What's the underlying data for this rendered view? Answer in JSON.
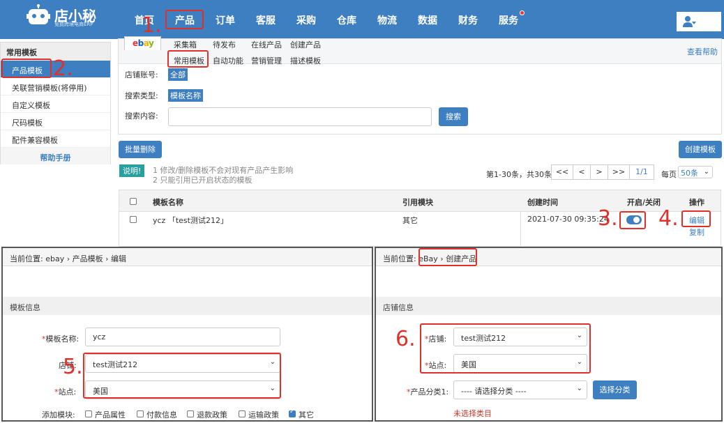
{
  "brand": {
    "name": "店小秘",
    "sub": "免费跨境电商ERP"
  },
  "nav": [
    "首页",
    "产品",
    "订单",
    "客服",
    "采购",
    "仓库",
    "物流",
    "数据",
    "财务",
    "服务"
  ],
  "annotations": [
    "1.",
    "2.",
    "3.",
    "4.",
    "5.",
    "6."
  ],
  "sidebar": {
    "title": "常用模板",
    "items": [
      "产品模板",
      "关联营销模板(将停用)",
      "自定义模板",
      "尺码模板",
      "配件兼容模板"
    ],
    "help": "帮助手册"
  },
  "tabs": {
    "platform": "ebay",
    "row1": [
      "采集箱",
      "待发布",
      "在线产品",
      "创建产品"
    ],
    "row2": [
      "常用模板",
      "自动功能",
      "营销管理",
      "描述模板"
    ],
    "help": "查看帮助"
  },
  "filters": {
    "shop_label": "店铺账号:",
    "shop_value": "全部",
    "search_type_label": "搜索类型:",
    "search_type_value": "模板名称",
    "search_content_label": "搜索内容:",
    "search_button": "搜索"
  },
  "actions": {
    "batch_delete": "批量删除",
    "create": "创建模板"
  },
  "notice": {
    "tag": "说明!",
    "lines": [
      "1 修改/删除模板不会对现有产品产生影响",
      "2 只能引用已开启状态的模板"
    ]
  },
  "pagination": {
    "summary": "第1-30条，共30条",
    "first": "<<",
    "prev": "<",
    "next": ">",
    "last": ">>",
    "page": "1/1",
    "per_page_label": "每页",
    "per_page": "50条"
  },
  "table": {
    "headers": [
      "模板名称",
      "引用模块",
      "创建时间",
      "开启/关闭",
      "操作"
    ],
    "rows": [
      {
        "name": "ycz 「test测试212」",
        "module": "其它",
        "created": "2021-07-30 09:35:24",
        "enabled": true,
        "edit": "编辑",
        "copy": "复制"
      }
    ]
  },
  "edit_panel": {
    "breadcrumb": [
      "当前位置:",
      "ebay",
      "产品模板",
      "编辑"
    ],
    "section": "模板信息",
    "name_label": "模板名称:",
    "name_value": "ycz",
    "shop_label": "店铺:",
    "shop_value": "test测试212",
    "site_label": "站点:",
    "site_value": "美国",
    "modules_label": "添加模块:",
    "modules": [
      {
        "label": "产品属性",
        "checked": false
      },
      {
        "label": "付款信息",
        "checked": false
      },
      {
        "label": "退款政策",
        "checked": false
      },
      {
        "label": "运输政策",
        "checked": false
      },
      {
        "label": "其它",
        "checked": true
      }
    ]
  },
  "create_panel": {
    "breadcrumb": [
      "当前位置:",
      "eBay",
      "创建产品"
    ],
    "section": "店铺信息",
    "shop_label": "店铺:",
    "shop_value": "test测试212",
    "site_label": "站点:",
    "site_value": "美国",
    "category_label": "产品分类1:",
    "category_value": "---- 请选择分类 ----",
    "category_button": "选择分类",
    "category_hint": "未选择类目"
  },
  "colors": {
    "brand": "#3d7fc1",
    "annotation": "#e0302a",
    "notice": "#27a0a0"
  }
}
